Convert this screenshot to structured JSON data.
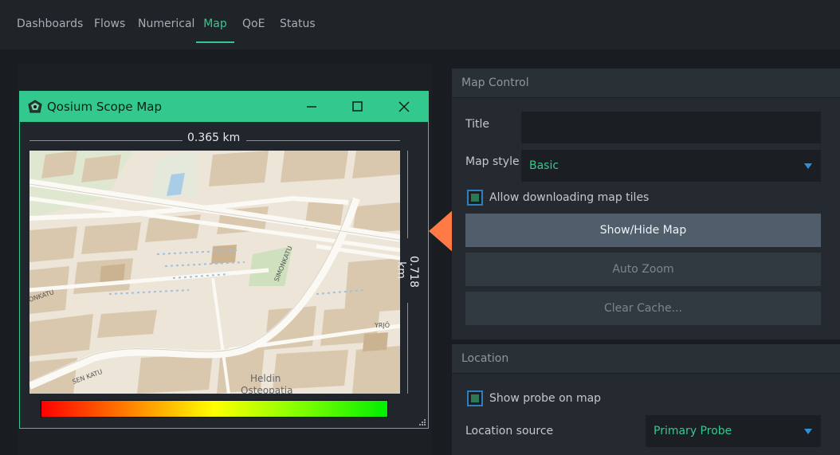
{
  "nav": {
    "tabs": [
      "Dashboards",
      "Flows",
      "Numerical",
      "Map",
      "QoE",
      "Status"
    ],
    "active": "Map"
  },
  "map_window": {
    "title": "Qosium Scope Map",
    "scale_horizontal": "0.365 km",
    "scale_vertical": "0.718 km",
    "map_labels": {
      "street_1": "SEN KATU",
      "street_2": "YRJÖ",
      "street_3": "ONKATU",
      "street_4": "SIMONKATU",
      "poi": "Heldin",
      "poi_2": "Osteopatia"
    }
  },
  "colors": {
    "accent": "#33c98e",
    "arrow": "#ff7a45",
    "primary_button": "#505e6c"
  },
  "map_control": {
    "header": "Map Control",
    "title_label": "Title",
    "title_value": "",
    "style_label": "Map style",
    "style_value": "Basic",
    "allow_download_label": "Allow downloading map tiles",
    "show_hide_button": "Show/Hide Map",
    "auto_zoom_button": "Auto Zoom",
    "clear_cache_button": "Clear Cache..."
  },
  "location": {
    "header": "Location",
    "show_probe_label": "Show probe on map",
    "source_label": "Location source",
    "source_value": "Primary Probe"
  }
}
